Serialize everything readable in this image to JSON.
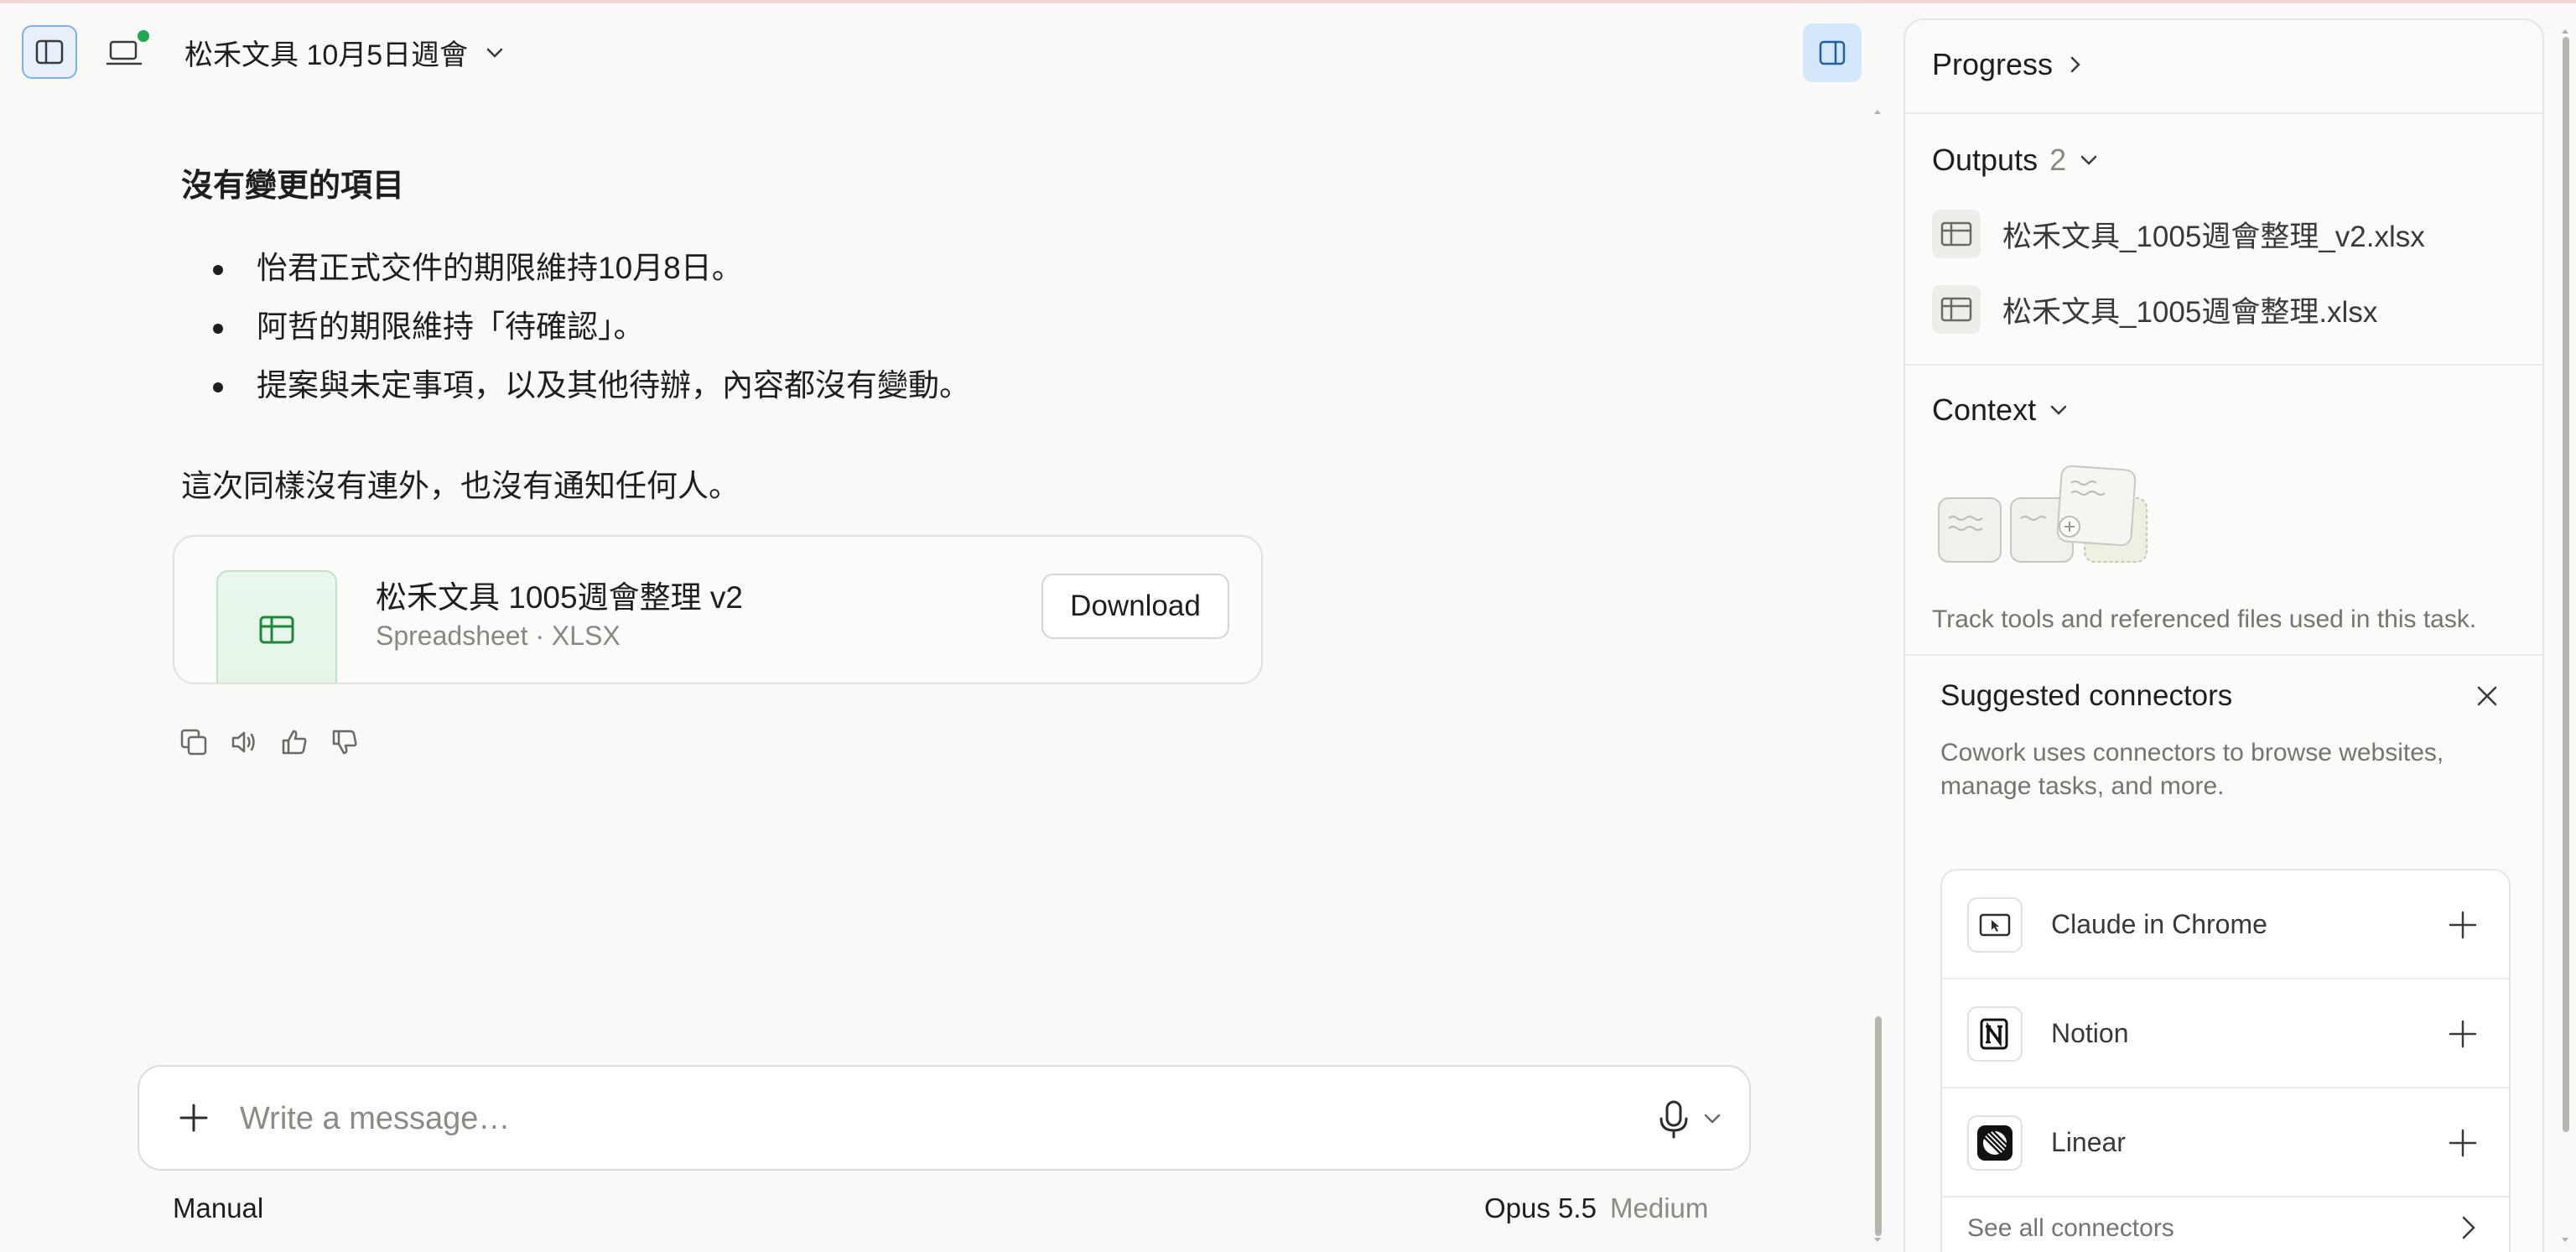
{
  "header": {
    "title": "松禾文具 10月5日週會"
  },
  "message": {
    "heading": "沒有變更的項目",
    "bullets": [
      "怡君正式交件的期限維持10月8日。",
      "阿哲的期限維持「待確認」。",
      "提案與未定事項，以及其他待辦，內容都沒有變動。"
    ],
    "note": "這次同樣沒有連外，也沒有通知任何人。"
  },
  "file_card": {
    "name": "松禾文具 1005週會整理 v2",
    "meta": "Spreadsheet · XLSX",
    "download_label": "Download"
  },
  "composer": {
    "placeholder": "Write a message…",
    "mode": "Manual",
    "model": "Opus 5.5",
    "effort": "Medium"
  },
  "panel": {
    "progress_label": "Progress",
    "outputs_label": "Outputs",
    "outputs_count": "2",
    "outputs": [
      {
        "name": "松禾文具_1005週會整理_v2.xlsx"
      },
      {
        "name": "松禾文具_1005週會整理.xlsx"
      }
    ],
    "context_label": "Context",
    "context_note": "Track tools and referenced files used in this task.",
    "connectors": {
      "title": "Suggested connectors",
      "description": "Cowork uses connectors to browse websites, manage tasks, and more.",
      "items": [
        {
          "name": "Claude in Chrome",
          "icon": "chrome-cursor-icon"
        },
        {
          "name": "Notion",
          "icon": "notion-icon"
        },
        {
          "name": "Linear",
          "icon": "linear-icon"
        }
      ],
      "see_all": "See all connectors"
    }
  },
  "colors": {
    "accent_blue": "#d4e6fa",
    "status_green": "#1fa84d",
    "spreadsheet_green": "#1a8a3a"
  }
}
